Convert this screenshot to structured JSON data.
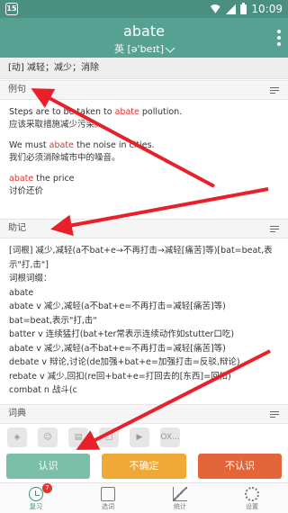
{
  "status_bar": {
    "app_badge": "15",
    "time": "10:09"
  },
  "header": {
    "word": "abate",
    "phonetic": "英 [ə'beɪt]"
  },
  "definition": "[动] 减轻；减少；消除",
  "sections": {
    "examples": "例句",
    "memory": "助记",
    "dictionary": "词典"
  },
  "examples": [
    {
      "pre": "Steps are to be taken to ",
      "highlight": "abate",
      "post": " pollution.",
      "translation": "应该采取措施减少污染。"
    },
    {
      "pre": "We must ",
      "highlight": "abate",
      "post": " the noise in cities.",
      "translation": "我们必须消除城市中的噪音。"
    },
    {
      "pre": "",
      "highlight": "abate",
      "post": " the price",
      "translation": "讨价还价"
    }
  ],
  "memory_lines": [
    "[词根] 减少,减轻(a不bat+e→不再打击→减轻[痛苦]等)[bat=beat,表示\"打,击\"]",
    "词根词缀：",
    "abate",
    "abate v 减少,减轻(a不bat+e=不再打击=减轻[痛苦]等)",
    "bat=beat,表示\"打,击\"",
    "batter v 连续猛打(bat+ter常表示连续动作如stutter口吃)",
    "abate v 减少,减轻(a不bat+e=不再打击=减轻[痛苦]等)",
    "debate v 辩论,讨论(de加强+bat+e=加强打击=反驳,辩论)",
    "rebate v 减少,回扣(re回+bat+e=打回去的[东西]=回扣)",
    "combat n 战斗(c"
  ],
  "dict_icons": [
    "dict-1-icon",
    "dict-2-icon",
    "dict-3-icon",
    "dict-4-icon",
    "bing-icon",
    "oxford-icon"
  ],
  "dict_oxford_label": "OX...",
  "buttons": {
    "know": "认识",
    "unsure": "不确定",
    "unknown": "不认识"
  },
  "nav": {
    "review": "复习",
    "review_badge": "7",
    "words": "选词",
    "stats": "统计",
    "settings": "设置"
  },
  "colors": {
    "header": "#56a191",
    "know": "#7cbfa8",
    "unsure": "#f0a836",
    "unknown": "#e2663a",
    "highlight": "#e0342c",
    "arrow": "#e8202a"
  }
}
